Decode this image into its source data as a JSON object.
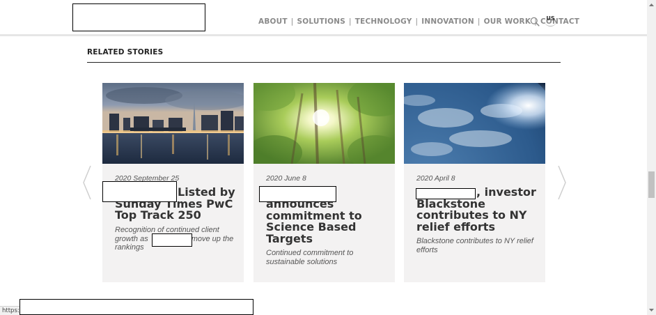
{
  "nav": {
    "items": [
      "ABOUT",
      "SOLUTIONS",
      "TECHNOLOGY",
      "INNOVATION",
      "OUR WORK",
      "CONTACT"
    ],
    "separator": "|",
    "language": "US"
  },
  "section": {
    "title": "RELATED STORIES"
  },
  "stories": [
    {
      "date": "2020 September 25",
      "title_visible": "Listed by Sunday Times PwC Top Track 250",
      "title_line1": "Listed",
      "title_rest": "by Sunday Times PwC Top Track 250",
      "description_part1": "Recognition of continued client growth as",
      "description_part2": "move up the rankings"
    },
    {
      "date": "2020 June 8",
      "title": "announces commitment to Science Based Targets",
      "description": "Continued commitment to sustainable solutions"
    },
    {
      "date": "2020 April 8",
      "title_line1": ", investor",
      "title_rest": "Blackstone contributes to NY relief efforts",
      "description": "Blackstone contributes to NY relief efforts"
    }
  ],
  "status_bar": {
    "url": "https:/"
  },
  "icons": {
    "search": "search-icon",
    "prev": "chevron-left-icon",
    "next": "chevron-right-icon"
  },
  "colors": {
    "nav_text": "#8a8a8a",
    "card_bg": "#f3f2f2",
    "title_text": "#333333"
  }
}
